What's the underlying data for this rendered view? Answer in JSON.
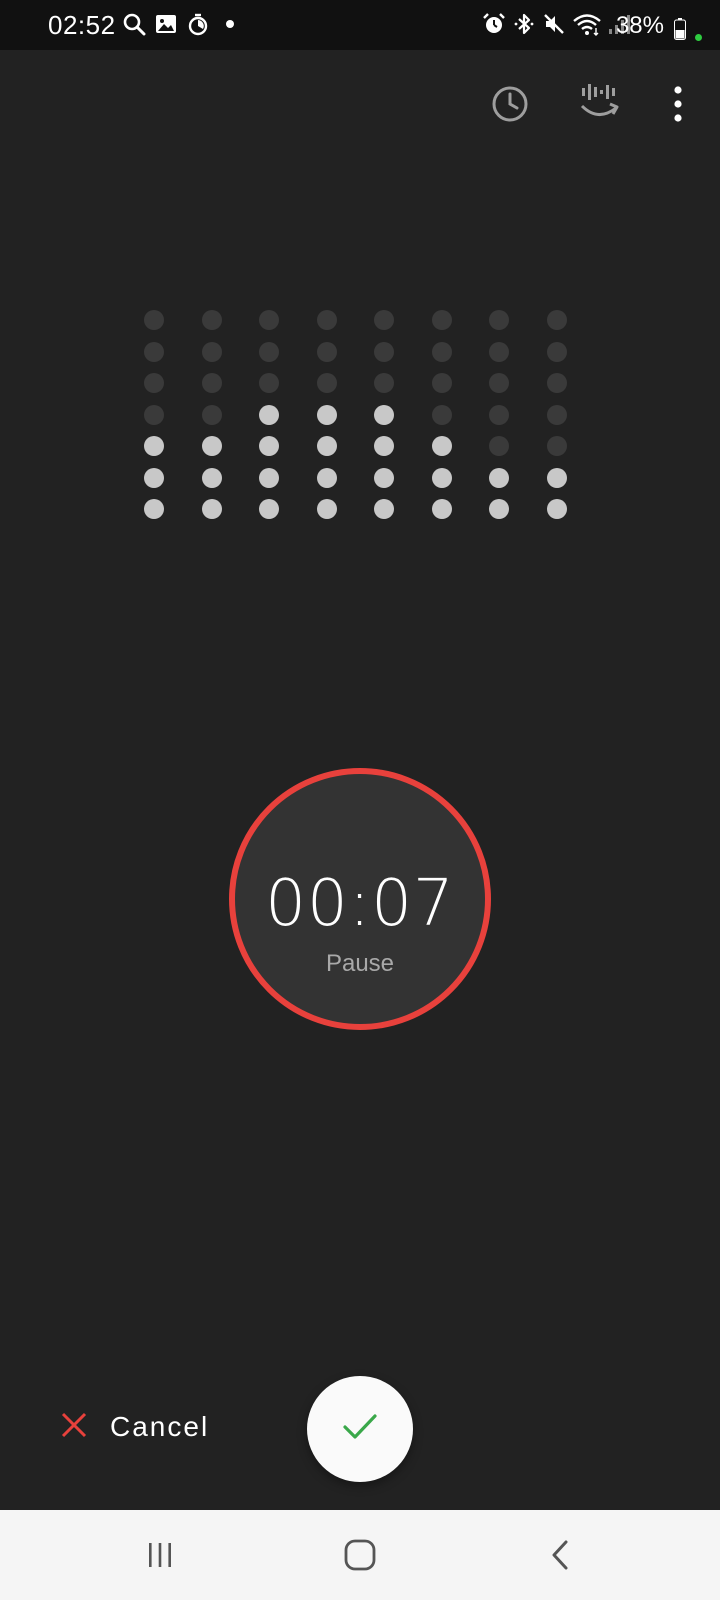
{
  "status_bar": {
    "time": "02:52",
    "battery": "38%",
    "left_icons": [
      "search-icon",
      "gallery-icon",
      "timer-icon",
      "notification-dot-icon"
    ],
    "right_icons": [
      "alarm-icon",
      "bluetooth-icon",
      "mute-icon",
      "wifi-icon",
      "signal-icon"
    ]
  },
  "toolbar": {
    "icons": [
      "history-clock-icon",
      "voice-to-text-icon",
      "more-options-icon"
    ]
  },
  "waveform": {
    "columns": 8,
    "rows": 7,
    "active_dot_counts": [
      3,
      3,
      4,
      4,
      4,
      3,
      2,
      2
    ],
    "colors": {
      "active": "#c8c8c8",
      "inactive": "#3a3a3a"
    }
  },
  "recorder": {
    "elapsed": "00:07",
    "action_label": "Pause",
    "ring_color": "#e8413c"
  },
  "actions": {
    "cancel_label": "Cancel",
    "cancel_color": "#e8413c",
    "confirm_color": "#3aa84a"
  },
  "navigation": {
    "icons": [
      "recent-apps-icon",
      "home-icon",
      "back-icon"
    ]
  }
}
